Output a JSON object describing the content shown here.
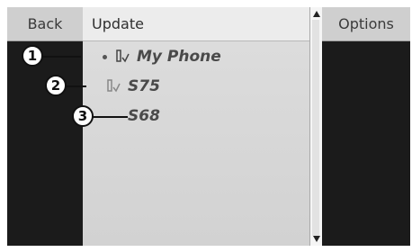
{
  "softkeys": {
    "back_label": "Back",
    "options_label": "Options"
  },
  "main": {
    "title": "Update",
    "items": [
      {
        "label": "My Phone",
        "icon": "phone-icon",
        "marker": "bullet"
      },
      {
        "label": "S75",
        "icon": "phone-icon"
      },
      {
        "label": "S68"
      }
    ]
  },
  "callouts": [
    "1",
    "2",
    "3"
  ]
}
